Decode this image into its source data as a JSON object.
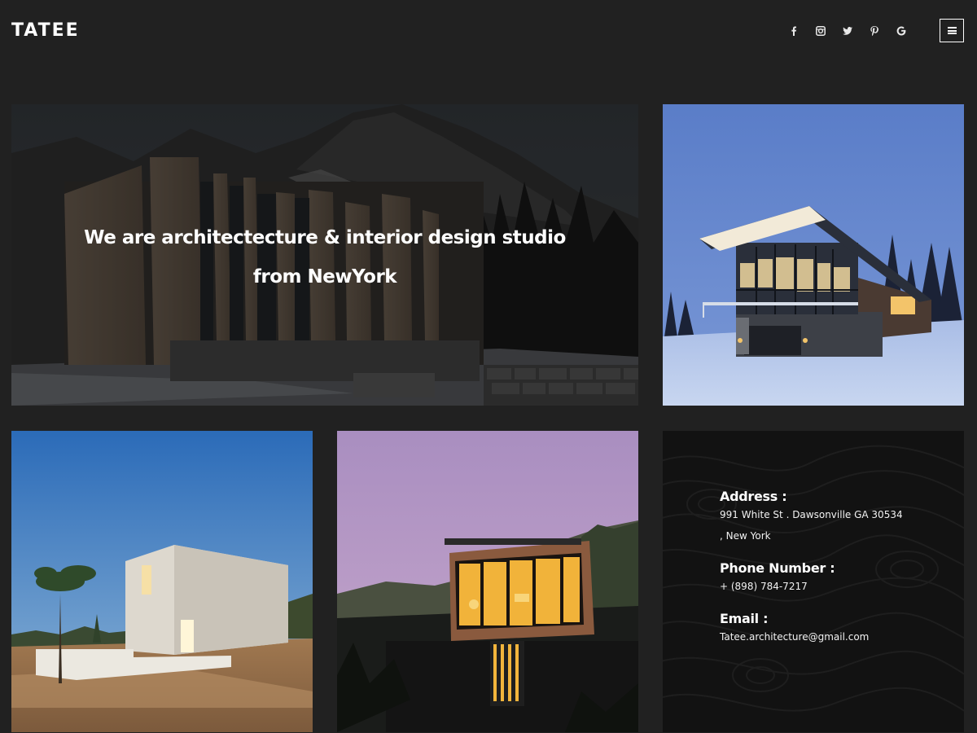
{
  "header": {
    "logo": "TATEE",
    "social": [
      {
        "icon": "facebook-icon",
        "glyph": "f"
      },
      {
        "icon": "instagram-icon",
        "glyph": "◙"
      },
      {
        "icon": "twitter-icon",
        "glyph": "🐦"
      },
      {
        "icon": "pinterest-icon",
        "glyph": "P"
      },
      {
        "icon": "google-icon",
        "glyph": "G"
      }
    ],
    "menu_icon": "hamburger-menu-icon"
  },
  "hero": {
    "line1": "We are architectecture & interior design studio",
    "line2": "from NewYork"
  },
  "contact": {
    "address_label": "Address :",
    "address_line1": "991 White St . Dawsonville GA 30534",
    "address_line2": ", New York",
    "phone_label": "Phone Number :",
    "phone_value": "+ (898) 784-7217",
    "email_label": "Email :",
    "email_value": "Tatee.architecture@gmail.com"
  },
  "colors": {
    "background": "#212121",
    "contact_bg": "#111111",
    "text": "#ffffff"
  }
}
